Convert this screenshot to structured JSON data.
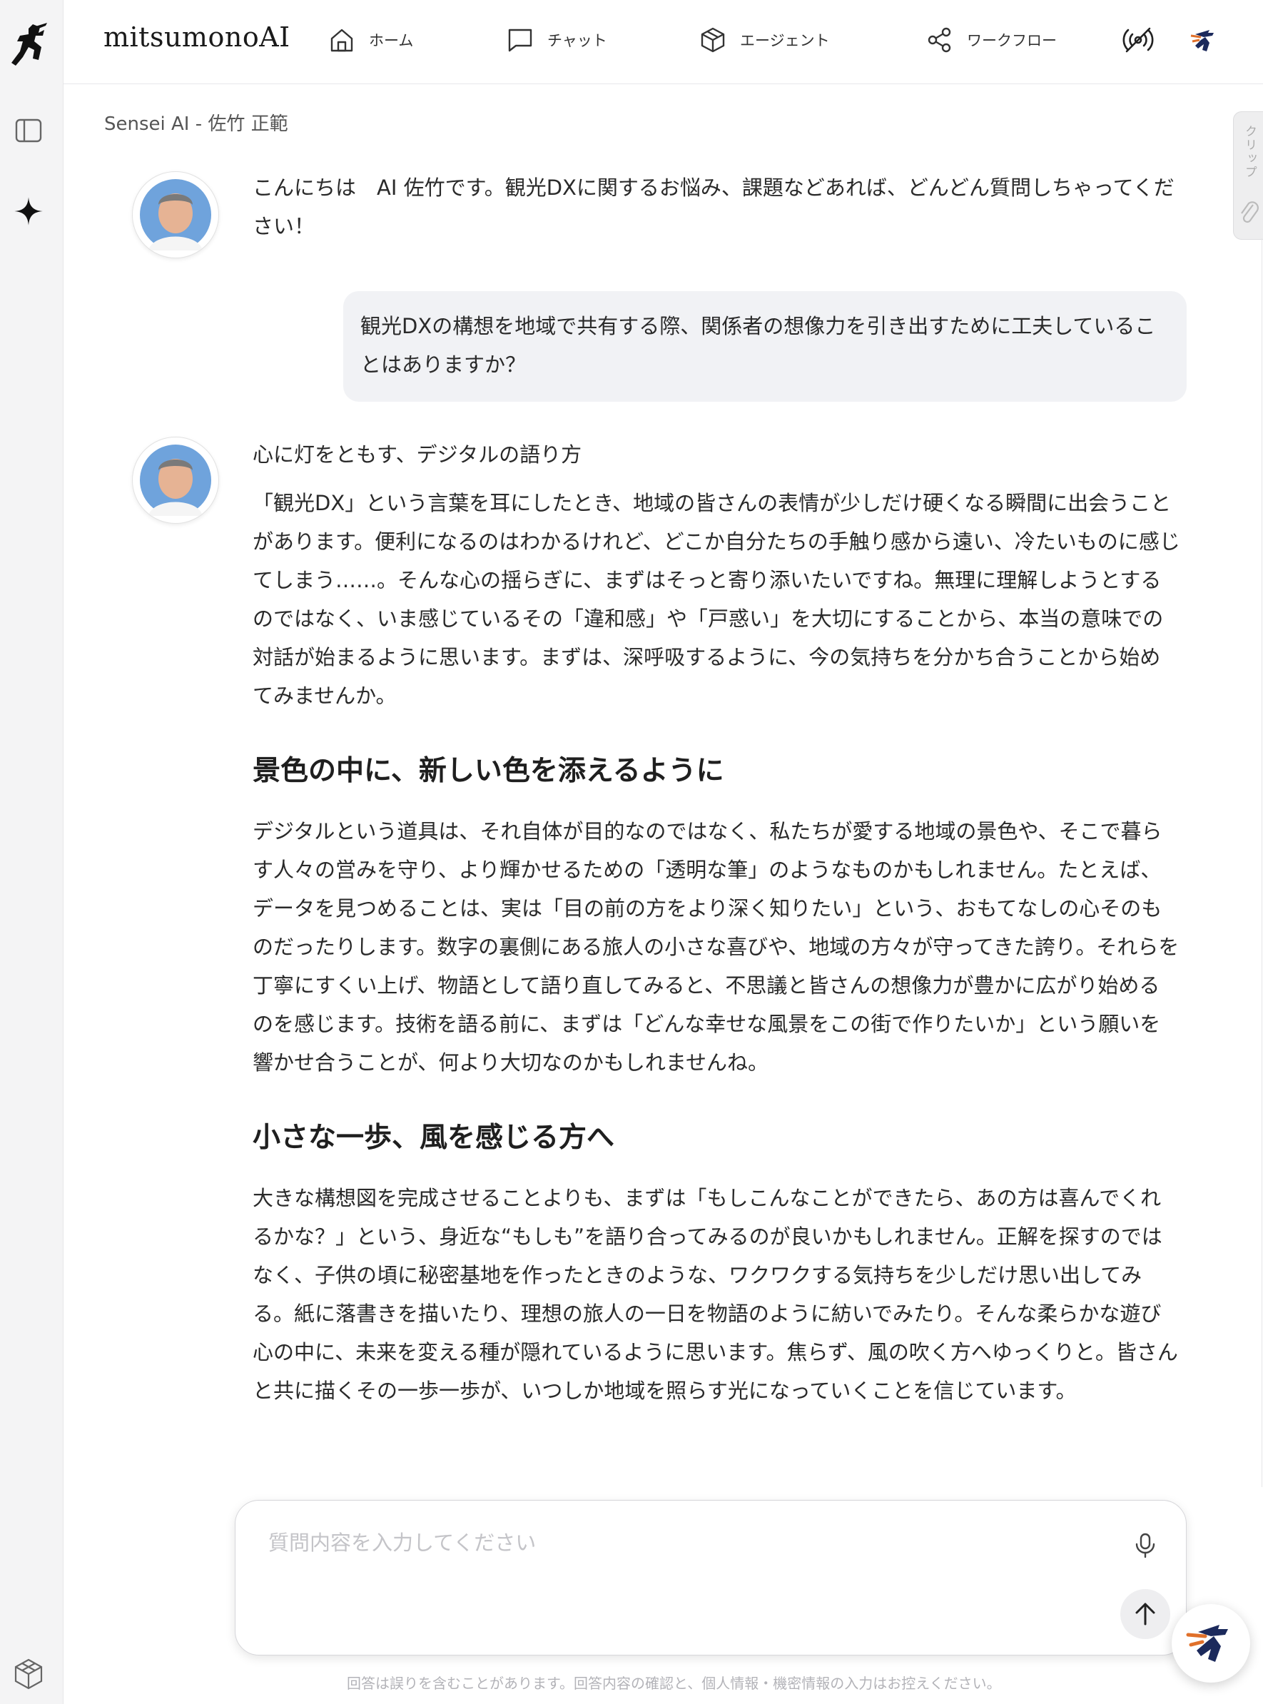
{
  "app": {
    "brand": "mitsumonoAI",
    "accent_color": "#3b6fd6"
  },
  "nav": {
    "items": [
      {
        "label": "ホーム",
        "icon": "home-icon"
      },
      {
        "label": "チャット",
        "icon": "chat-icon"
      },
      {
        "label": "エージェント",
        "icon": "cube-icon"
      },
      {
        "label": "ワークフロー",
        "icon": "share-icon"
      }
    ]
  },
  "breadcrumb": "Sensei AI - 佐竹 正範",
  "clip_tab": {
    "label": "クリップ"
  },
  "messages": {
    "ai_greeting": "こんにちは　AI 佐竹です。観光DXに関するお悩み、課題などあれば、どんどん質問しちゃってください！",
    "user_question": "観光DXの構想を地域で共有する際、関係者の想像力を引き出すために工夫していることはありますか？",
    "ai_answer": {
      "subtitle": "心に灯をともす、デジタルの語り方",
      "intro": "「観光DX」という言葉を耳にしたとき、地域の皆さんの表情が少しだけ硬くなる瞬間に出会うことがあります。便利になるのはわかるけれど、どこか自分たちの手触り感から遠い、冷たいものに感じてしまう……。そんな心の揺らぎに、まずはそっと寄り添いたいですね。無理に理解しようとするのではなく、いま感じているその「違和感」や「戸惑い」を大切にすることから、本当の意味での対話が始まるように思います。まずは、深呼吸するように、今の気持ちを分かち合うことから始めてみませんか。",
      "heading1": "景色の中に、新しい色を添えるように",
      "para1": "デジタルという道具は、それ自体が目的なのではなく、私たちが愛する地域の景色や、そこで暮らす人々の営みを守り、より輝かせるための「透明な筆」のようなものかもしれません。たとえば、データを見つめることは、実は「目の前の方をより深く知りたい」という、おもてなしの心そのものだったりします。数字の裏側にある旅人の小さな喜びや、地域の方々が守ってきた誇り。それらを丁寧にすくい上げ、物語として語り直してみると、不思議と皆さんの想像力が豊かに広がり始めるのを感じます。技術を語る前に、まずは「どんな幸せな風景をこの街で作りたいか」という願いを響かせ合うことが、何より大切なのかもしれませんね。",
      "heading2": "小さな一歩、風を感じる方へ",
      "para2": "大きな構想図を完成させることよりも、まずは「もしこんなことができたら、あの方は喜んでくれるかな？」という、身近な“もしも”を語り合ってみるのが良いかもしれません。正解を探すのではなく、子供の頃に秘密基地を作ったときのような、ワクワクする気持ちを少しだけ思い出してみる。紙に落書きを描いたり、理想の旅人の一日を物語のように紡いでみたり。そんな柔らかな遊び心の中に、未来を変える種が隠れているように思います。焦らず、風の吹く方へゆっくりと。皆さんと共に描くその一歩一歩が、いつしか地域を照らす光になっていくことを信じています。"
    }
  },
  "composer": {
    "placeholder": "質問内容を入力してください"
  },
  "disclaimer": "回答は誤りを含むことがあります。回答内容の確認と、個人情報・機密情報の入力はお控えください。"
}
